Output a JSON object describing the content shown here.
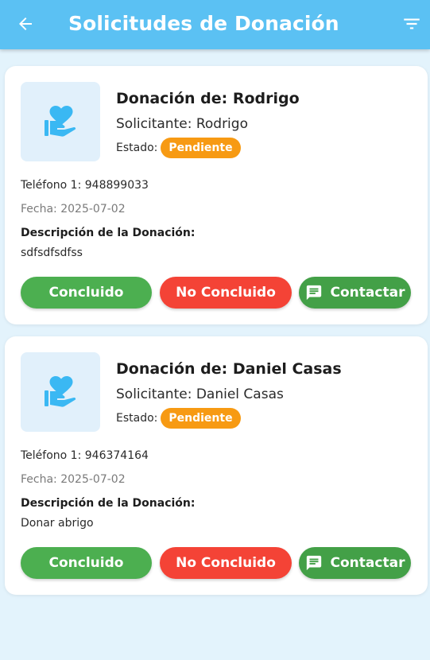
{
  "appbar": {
    "title": "Solicitudes de Donación",
    "back_icon": "arrow-left-icon",
    "filter_icon": "filter-icon",
    "color": "#5bc1f3"
  },
  "cards": [
    {
      "title": "Donación de: Rodrigo",
      "solicitante_label": "Solicitante:",
      "solicitante": "Rodrigo",
      "estado_label": "Estado:",
      "estado": "Pendiente",
      "telefono_label": "Teléfono 1:",
      "telefono": "948899033",
      "fecha_label": "Fecha:",
      "fecha": "2025-07-02",
      "descripcion_label": "Descripción de la Donación:",
      "descripcion": "sdfsdfsdfss",
      "icon": "volunteer-heart-hand-icon",
      "buttons": {
        "done": "Concluido",
        "not_done": "No Concluido",
        "contact": "Contactar"
      }
    },
    {
      "title": "Donación de: Daniel Casas",
      "solicitante_label": "Solicitante:",
      "solicitante": "Daniel Casas",
      "estado_label": "Estado:",
      "estado": "Pendiente",
      "telefono_label": "Teléfono 1:",
      "telefono": "946374164",
      "fecha_label": "Fecha:",
      "fecha": "2025-07-02",
      "descripcion_label": "Descripción de la Donación:",
      "descripcion": "Donar abrigo",
      "icon": "volunteer-heart-hand-icon",
      "buttons": {
        "done": "Concluido",
        "not_done": "No Concluido",
        "contact": "Contactar"
      }
    }
  ],
  "colors": {
    "done": "#4caf50",
    "not_done": "#f44336",
    "contact": "#43a047",
    "badge_pending": "#f79a13",
    "background": "#e3f3fc"
  }
}
